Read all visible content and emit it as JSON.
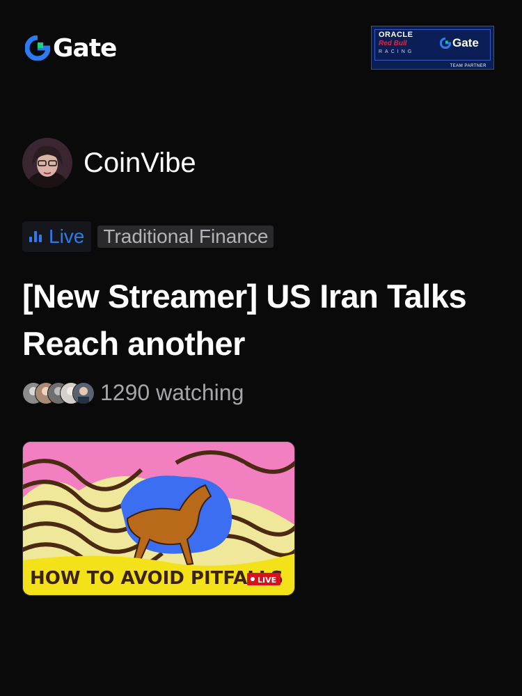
{
  "brand": {
    "logo_text": "Gate",
    "accent": "#2c7bf0",
    "accent_green": "#17d47b"
  },
  "partner_badge": {
    "line1": "ORACLE",
    "line2": "Red Bull",
    "line3": "RACING",
    "gate_text": "Gate",
    "footer": "TEAM PARTNER"
  },
  "streamer": {
    "name": "CoinVibe",
    "avatar_icon": "streamer-avatar"
  },
  "tags": {
    "live_label": "Live",
    "category": "Traditional Finance"
  },
  "stream": {
    "title": "[New Streamer] US Iran Talks Reach another",
    "watching": "1290 watching"
  },
  "thumbnail": {
    "caption": "HOW TO AVOID PITFALLS",
    "live_badge": "LIVE"
  }
}
